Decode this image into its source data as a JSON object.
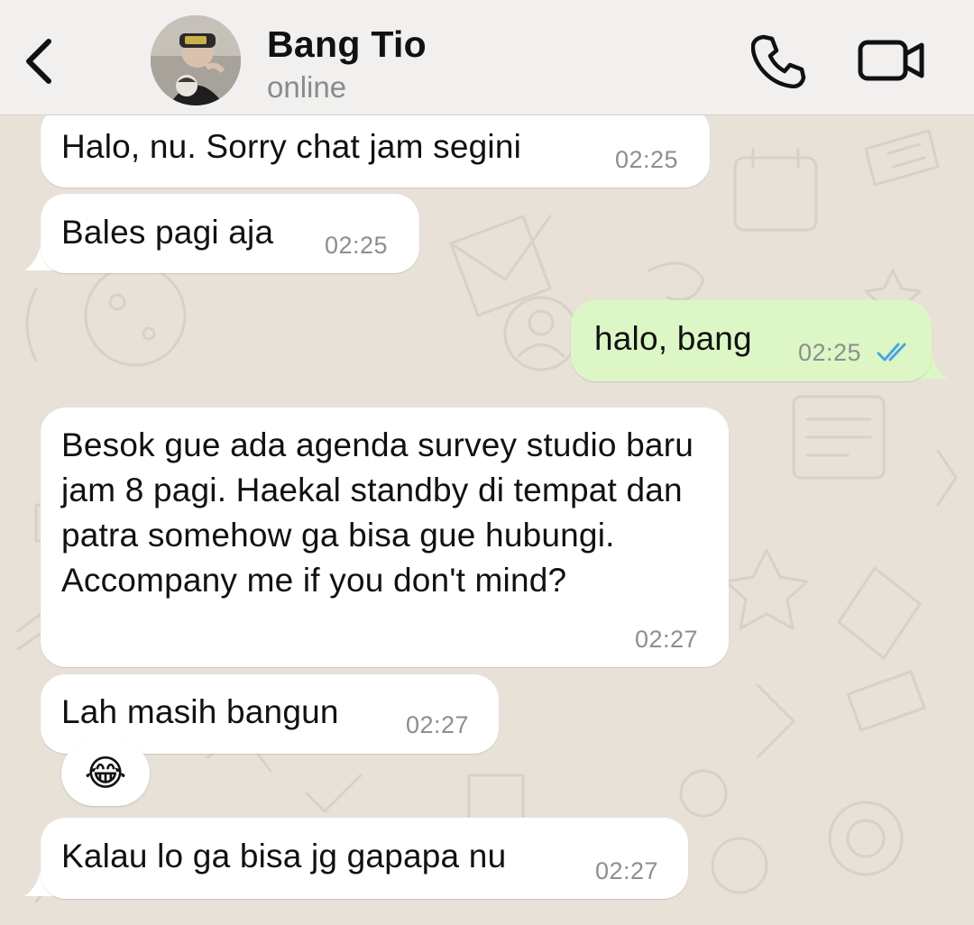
{
  "header": {
    "contact_name": "Bang Tio",
    "status": "online"
  },
  "messages": [
    {
      "direction": "incoming",
      "text": "Halo, nu. Sorry chat jam segini",
      "time": "02:25"
    },
    {
      "direction": "incoming",
      "text": "Bales pagi aja",
      "time": "02:25"
    },
    {
      "direction": "outgoing",
      "text": "halo, bang",
      "time": "02:25",
      "read": true
    },
    {
      "direction": "incoming",
      "text": "Besok gue ada agenda survey studio baru jam 8 pagi. Haekal standby di tempat dan patra somehow ga bisa gue hubungi. Accompany me if you don't mind?",
      "time": "02:27"
    },
    {
      "direction": "incoming",
      "text": "Lah masih bangun",
      "time": "02:27",
      "reaction": "😂"
    },
    {
      "direction": "incoming",
      "text": "Kalau lo ga bisa jg gapapa nu",
      "time": "02:27"
    }
  ],
  "colors": {
    "incoming_bubble": "#ffffff",
    "outgoing_bubble": "#dcf7c5",
    "chat_background": "#e7e1d8",
    "read_ticks": "#4fa3e0",
    "header_background": "#f2f0ee"
  },
  "icons": {
    "back": "chevron-left-icon",
    "call": "phone-icon",
    "video": "video-camera-icon",
    "read_receipt": "double-check-icon"
  }
}
